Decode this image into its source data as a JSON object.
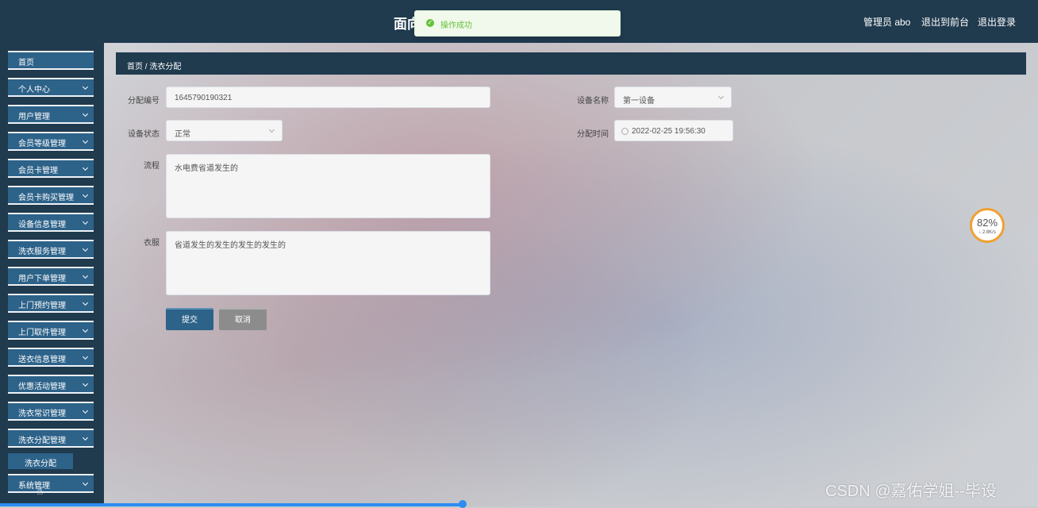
{
  "header": {
    "title": "面向...实现",
    "admin_label": "管理员 abo",
    "back_frontend": "退出到前台",
    "logout": "退出登录"
  },
  "toast": {
    "message": "操作成功",
    "icon": "success-check-icon"
  },
  "sidebar": {
    "items": [
      {
        "label": "首页",
        "expandable": false
      },
      {
        "label": "个人中心",
        "expandable": true
      },
      {
        "label": "用户管理",
        "expandable": true
      },
      {
        "label": "会员等级管理",
        "expandable": true
      },
      {
        "label": "会员卡管理",
        "expandable": true
      },
      {
        "label": "会员卡购买管理",
        "expandable": true
      },
      {
        "label": "设备信息管理",
        "expandable": true
      },
      {
        "label": "洗衣服务管理",
        "expandable": true
      },
      {
        "label": "用户下单管理",
        "expandable": true
      },
      {
        "label": "上门预约管理",
        "expandable": true
      },
      {
        "label": "上门取件管理",
        "expandable": true
      },
      {
        "label": "送衣信息管理",
        "expandable": true
      },
      {
        "label": "优惠活动管理",
        "expandable": true
      },
      {
        "label": "洗衣常识管理",
        "expandable": true
      },
      {
        "label": "洗衣分配管理",
        "expandable": true
      },
      {
        "label": "系统管理",
        "expandable": true
      }
    ],
    "submenu": {
      "label": "洗衣分配"
    }
  },
  "breadcrumb": {
    "text": "首页 / 洗衣分配"
  },
  "form": {
    "alloc_no_label": "分配编号",
    "alloc_no_value": "1645790190321",
    "device_name_label": "设备名称",
    "device_name_value": "第一设备",
    "device_status_label": "设备状态",
    "device_status_value": "正常",
    "alloc_time_label": "分配时间",
    "alloc_time_value": "2022-02-25 19:56:30",
    "process_label": "流程",
    "process_value": "水电费省道发生的",
    "clothes_label": "衣服",
    "clothes_value": "省道发生的发生的发生的发生的",
    "submit_label": "提交",
    "cancel_label": "取消"
  },
  "gauge": {
    "percent": "82%",
    "speed": "↓ 2.8K/s"
  },
  "watermark": "CSDN @嘉佑学姐--毕设",
  "page_load_progress": 0.446,
  "colors": {
    "header_bg": "#203a4e",
    "menu_item_bg": "#2d6289",
    "toast_text": "#67c23a",
    "progress": "#2d8cf0"
  }
}
